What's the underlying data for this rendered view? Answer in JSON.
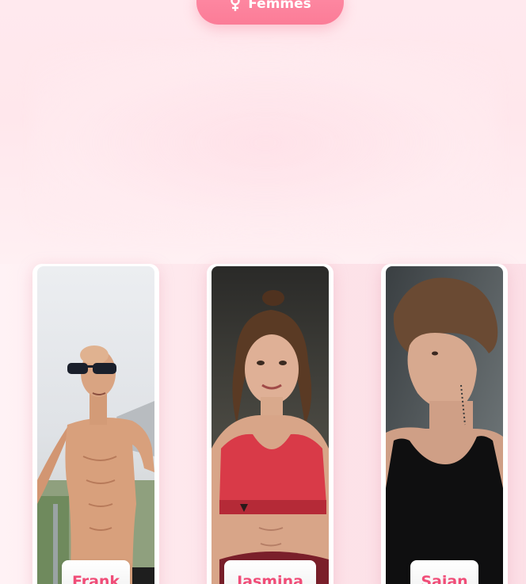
{
  "filter": {
    "label": "Femmes",
    "icon": "female-icon"
  },
  "profiles": [
    {
      "name": "Frank"
    },
    {
      "name": "Jasmina"
    },
    {
      "name": "Sajan"
    }
  ],
  "colors": {
    "accent": "#fb7c97",
    "name_text": "#f04d78",
    "background": "#fdebef"
  }
}
